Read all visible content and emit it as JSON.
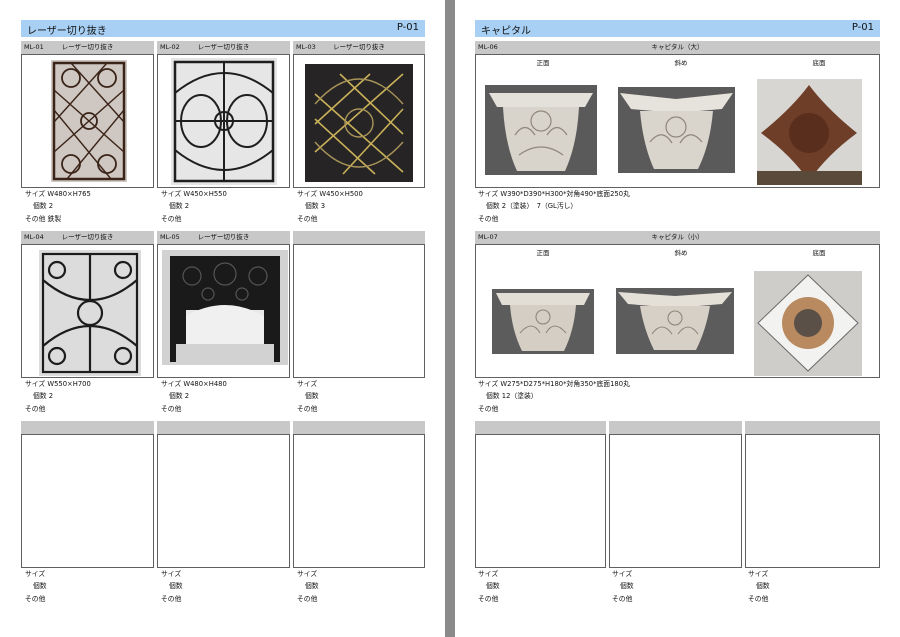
{
  "left_page": {
    "title": "レーザー切り抜き",
    "page_no": "P-01",
    "items": [
      {
        "code": "ML-01",
        "name": "レーザー切り抜き",
        "size": "サイズ W480×H765",
        "count": "個数 2",
        "other": "その他 鉄製"
      },
      {
        "code": "ML-02",
        "name": "レーザー切り抜き",
        "size": "サイズ W450×H550",
        "count": "個数 2",
        "other": "その他"
      },
      {
        "code": "ML-03",
        "name": "レーザー切り抜き",
        "size": "サイズ W450×H500",
        "count": "個数 3",
        "other": "その他"
      },
      {
        "code": "ML-04",
        "name": "レーザー切り抜き",
        "size": "サイズ W550×H700",
        "count": "個数 2",
        "other": "その他"
      },
      {
        "code": "ML-05",
        "name": "レーザー切り抜き",
        "size": "サイズ W480×H480",
        "count": "個数 2",
        "other": "その他"
      },
      {
        "code": "",
        "name": "",
        "size": "サイズ",
        "count": "個数",
        "other": "その他"
      },
      {
        "code": "",
        "name": "",
        "size": "サイズ",
        "count": "個数",
        "other": "その他"
      },
      {
        "code": "",
        "name": "",
        "size": "サイズ",
        "count": "個数",
        "other": "その他"
      },
      {
        "code": "",
        "name": "",
        "size": "サイズ",
        "count": "個数",
        "other": "その他"
      }
    ]
  },
  "right_page": {
    "title": "キャピタル",
    "page_no": "P-01",
    "wide_items": [
      {
        "code": "ML-06",
        "name": "キャピタル（大）",
        "views": [
          "正面",
          "斜め",
          "底面"
        ],
        "size": "サイズ W390*D390*H300*対角490*底面250丸",
        "count": "個数 2（塗装）　7（GL汚し）",
        "other": "その他"
      },
      {
        "code": "ML-07",
        "name": "キャピタル（小）",
        "views": [
          "正面",
          "斜め",
          "底面"
        ],
        "size": "サイズ W275*D275*H180*対角350*底面180丸",
        "count": "個数 12（塗装）",
        "other": "その他"
      }
    ],
    "items": [
      {
        "size": "サイズ",
        "count": "個数",
        "other": "その他"
      },
      {
        "size": "サイズ",
        "count": "個数",
        "other": "その他"
      },
      {
        "size": "サイズ",
        "count": "個数",
        "other": "その他"
      }
    ]
  }
}
